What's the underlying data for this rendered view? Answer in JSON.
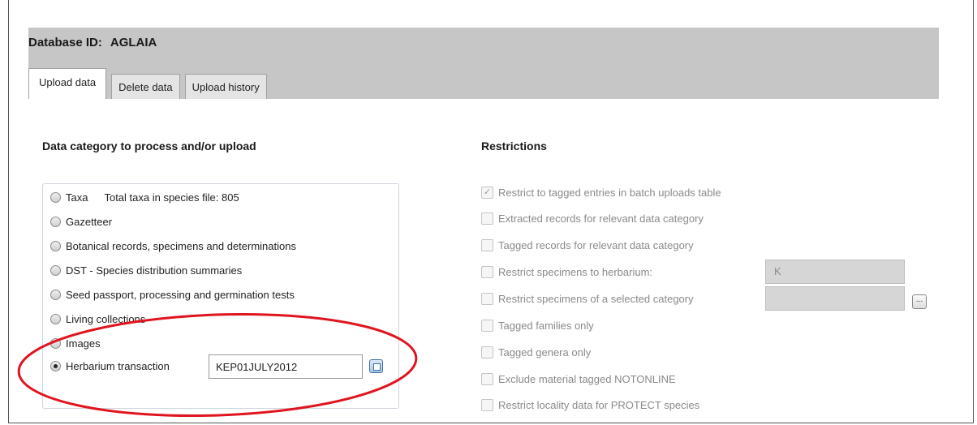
{
  "header": {
    "database_label": "Database ID:",
    "database_id": "AGLAIA"
  },
  "tabs": [
    {
      "label": "Upload data",
      "active": true
    },
    {
      "label": "Delete data",
      "active": false
    },
    {
      "label": "Upload history",
      "active": false
    }
  ],
  "categories": {
    "title": "Data category to process and/or upload",
    "total_taxa_text": "Total taxa in species file:  805",
    "items": [
      {
        "label": "Taxa",
        "selected": false
      },
      {
        "label": "Gazetteer",
        "selected": false
      },
      {
        "label": "Botanical records, specimens and determinations",
        "selected": false
      },
      {
        "label": "DST - Species distribution summaries",
        "selected": false
      },
      {
        "label": "Seed passport, processing and germination tests",
        "selected": false
      },
      {
        "label": "Living collections",
        "selected": false
      },
      {
        "label": "Images",
        "selected": false
      },
      {
        "label": "Herbarium transaction",
        "selected": true
      }
    ],
    "transaction_value": "KEP01JULY2012"
  },
  "restrictions": {
    "title": "Restrictions",
    "items": [
      {
        "label": "Restrict to tagged entries in batch uploads table",
        "checked": true
      },
      {
        "label": "Extracted records for relevant data category",
        "checked": false
      },
      {
        "label": "Tagged records for relevant data category",
        "checked": false
      },
      {
        "label": "Restrict specimens to herbarium:",
        "checked": false
      },
      {
        "label": "Restrict specimens of a selected category",
        "checked": false
      },
      {
        "label": "Tagged families only",
        "checked": false
      },
      {
        "label": "Tagged genera only",
        "checked": false
      },
      {
        "label": "Exclude material tagged NOTONLINE",
        "checked": false
      },
      {
        "label": "Restrict locality data for PROTECT species",
        "checked": false
      }
    ],
    "herbarium_value": "K",
    "ellipsis_label": "..."
  },
  "annotation_color": "#e0141e"
}
